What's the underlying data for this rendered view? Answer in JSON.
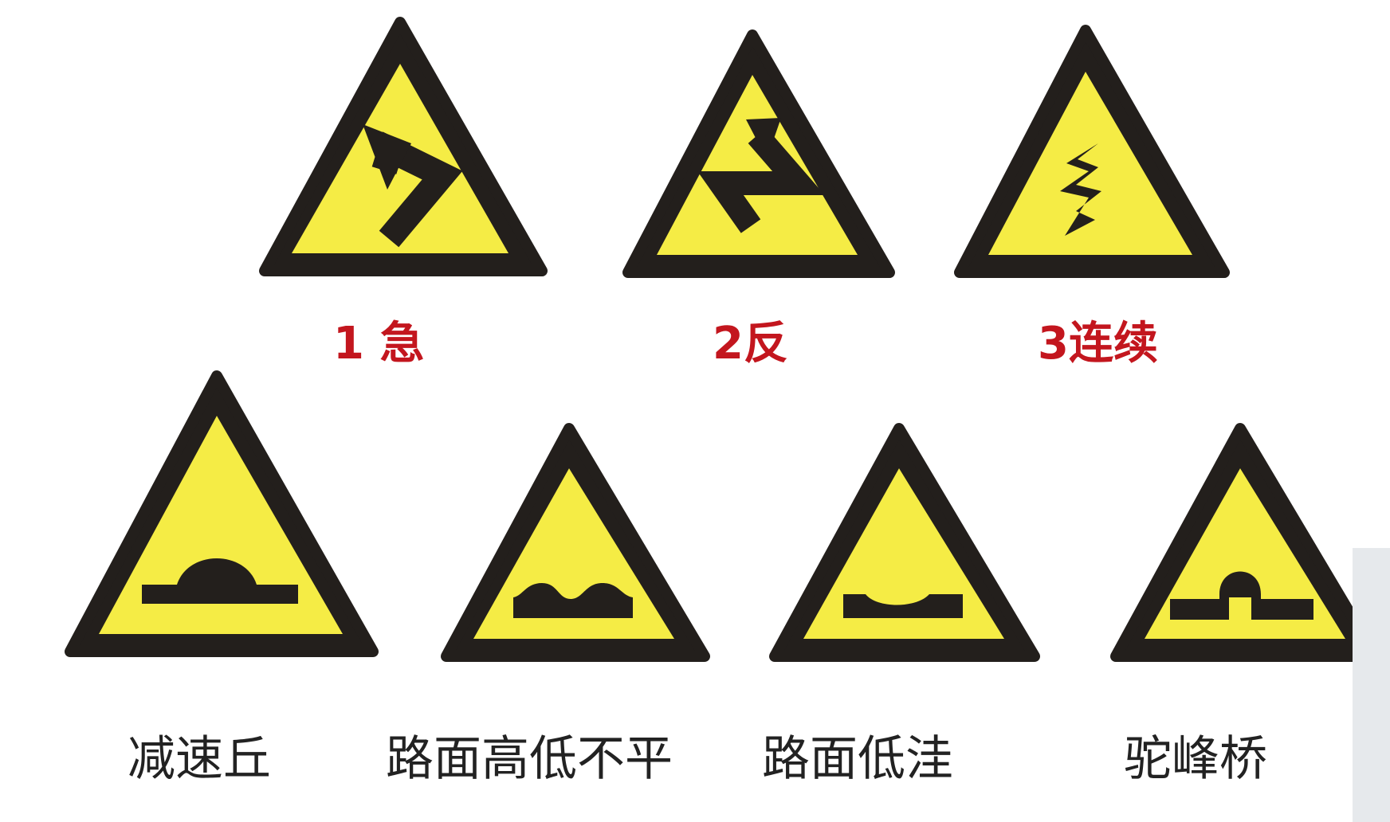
{
  "colors": {
    "sign_fill": "#f5ec45",
    "sign_border": "#231f1c",
    "top_label": "#c3161e",
    "bottom_label": "#222222"
  },
  "top_row": [
    {
      "label": "1 急",
      "icon": "sharp-curve-icon"
    },
    {
      "label": "2反",
      "icon": "reverse-curve-icon"
    },
    {
      "label": "3连续",
      "icon": "winding-road-icon"
    }
  ],
  "bottom_row": [
    {
      "label": "减速丘",
      "icon": "speed-bump-icon"
    },
    {
      "label": "路面高低不平",
      "icon": "uneven-road-icon"
    },
    {
      "label": "路面低洼",
      "icon": "road-dip-icon"
    },
    {
      "label": "驼峰桥",
      "icon": "hump-bridge-icon"
    }
  ]
}
